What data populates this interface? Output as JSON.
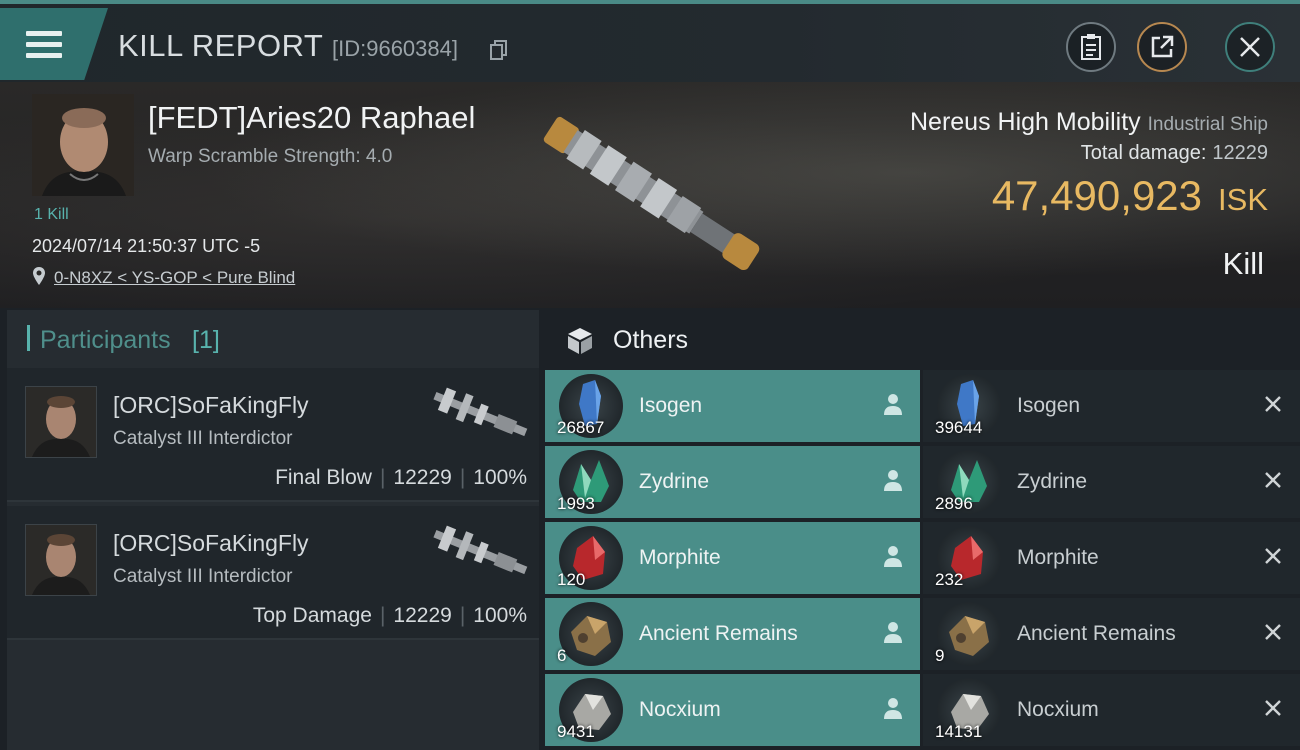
{
  "header": {
    "title": "KILL REPORT",
    "report_id": "[ID:9660384]"
  },
  "victim": {
    "pilot": "[FEDT]Aries20 Raphael",
    "warp_scramble": "Warp Scramble Strength: 4.0",
    "kills": "1 Kill",
    "timestamp": "2024/07/14 21:50:37 UTC -5",
    "location": "0-N8XZ < YS-GOP < Pure Blind"
  },
  "ship": {
    "name": "Nereus High Mobility",
    "class": "Industrial Ship",
    "total_damage_label": "Total damage:",
    "total_damage": "12229",
    "isk_value": "47,490,923",
    "isk_unit": "ISK",
    "kill_type": "Kill"
  },
  "participants": {
    "label": "Participants",
    "count": "[1]",
    "rows": [
      {
        "name": "[ORC]SoFaKingFly",
        "ship": "Catalyst III Interdictor",
        "role": "Final Blow",
        "damage": "12229",
        "percent": "100%"
      },
      {
        "name": "[ORC]SoFaKingFly",
        "ship": "Catalyst III Interdictor",
        "role": "Top Damage",
        "damage": "12229",
        "percent": "100%"
      }
    ]
  },
  "others": {
    "label": "Others",
    "dropped": [
      {
        "name": "Isogen",
        "qty": "26867",
        "icon": "isogen-icon"
      },
      {
        "name": "Zydrine",
        "qty": "1993",
        "icon": "zydrine-icon"
      },
      {
        "name": "Morphite",
        "qty": "120",
        "icon": "morphite-icon"
      },
      {
        "name": "Ancient Remains",
        "qty": "6",
        "icon": "ancient-remains-icon"
      },
      {
        "name": "Nocxium",
        "qty": "9431",
        "icon": "nocxium-icon"
      }
    ],
    "destroyed": [
      {
        "name": "Isogen",
        "qty": "39644",
        "icon": "isogen-icon"
      },
      {
        "name": "Zydrine",
        "qty": "2896",
        "icon": "zydrine-icon"
      },
      {
        "name": "Morphite",
        "qty": "232",
        "icon": "morphite-icon"
      },
      {
        "name": "Ancient Remains",
        "qty": "9",
        "icon": "ancient-remains-icon"
      },
      {
        "name": "Nocxium",
        "qty": "14131",
        "icon": "nocxium-icon"
      }
    ]
  },
  "colors": {
    "accent_teal": "#4a8e89",
    "isk_gold": "#e8b962"
  }
}
